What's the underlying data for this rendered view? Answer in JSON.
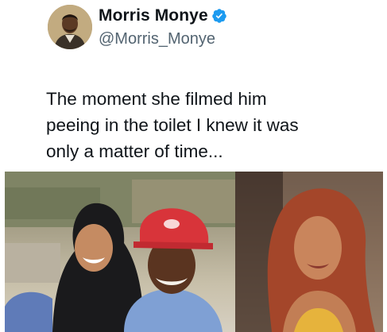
{
  "tweet": {
    "author": {
      "display_name": "Morris Monye",
      "handle": "@Morris_Monye",
      "verified_icon": "verified-badge-icon",
      "verified_color": "#1d9bf0"
    },
    "text_lines": [
      "The moment she filmed him",
      "peeing in the toilet I knew it was",
      "only a matter of time..."
    ]
  }
}
